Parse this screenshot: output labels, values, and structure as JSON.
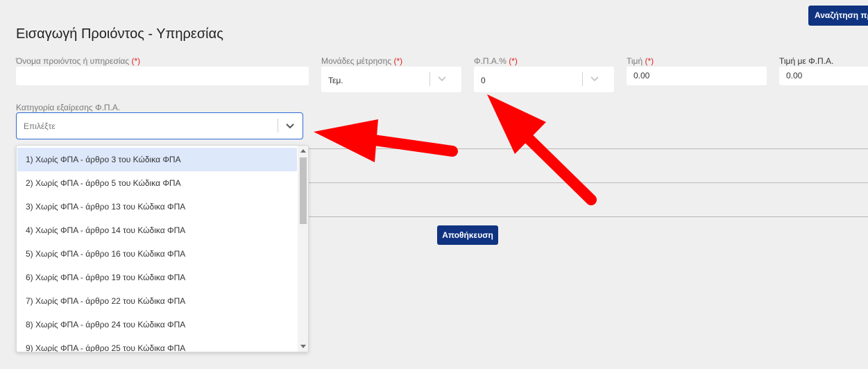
{
  "header": {
    "search_label": "Αναζήτηση πρ",
    "title": "Εισαγωγή Προιόντος - Υπηρεσίας"
  },
  "form": {
    "required_mark": "(*)",
    "name_label": "Όνομα προιόντος ή υπηρεσίας",
    "name_value": "",
    "units_label": "Μονάδες μέτρησης",
    "units_value": "Τεμ.",
    "vat_label": "Φ.Π.Α.%",
    "vat_value": "0",
    "price_label": "Τιμή",
    "price_value": "0.00",
    "price_vat_label": "Τιμή με Φ.Π.Α.",
    "price_vat_value": "0.00",
    "vat_exemption_label": "Κατηγορία εξαίρεσης Φ.Π.Α.",
    "vat_exemption_placeholder": "Επιλέξτε",
    "save_label": "Αποθήκευση"
  },
  "dropdown": {
    "options": [
      "1) Χωρίς ΦΠΑ - άρθρο 3 του Κώδικα ΦΠΑ",
      "2) Χωρίς ΦΠΑ - άρθρο 5 του Κώδικα ΦΠΑ",
      "3) Χωρίς ΦΠΑ - άρθρο 13 του Κώδικα ΦΠΑ",
      "4) Χωρίς ΦΠΑ - άρθρο 14 του Κώδικα ΦΠΑ",
      "5) Χωρίς ΦΠΑ - άρθρο 16 του Κώδικα ΦΠΑ",
      "6) Χωρίς ΦΠΑ - άρθρο 19 του Κώδικα ΦΠΑ",
      "7) Χωρίς ΦΠΑ - άρθρο 22 του Κώδικα ΦΠΑ",
      "8) Χωρίς ΦΠΑ - άρθρο 24 του Κώδικα ΦΠΑ",
      "9) Χωρίς ΦΠΑ - άρθρο 25 του Κώδικα ΦΠΑ"
    ],
    "highlighted_index": 0
  },
  "colors": {
    "primary": "#0f3380",
    "required": "#e02020",
    "focus_border": "#2c6ad6",
    "annotation_arrow": "#ff0000"
  },
  "icons": {
    "units_chevron": "chevron-down-icon",
    "vat_chevron": "chevron-down-icon",
    "exemption_chevron": "chevron-down-icon"
  }
}
